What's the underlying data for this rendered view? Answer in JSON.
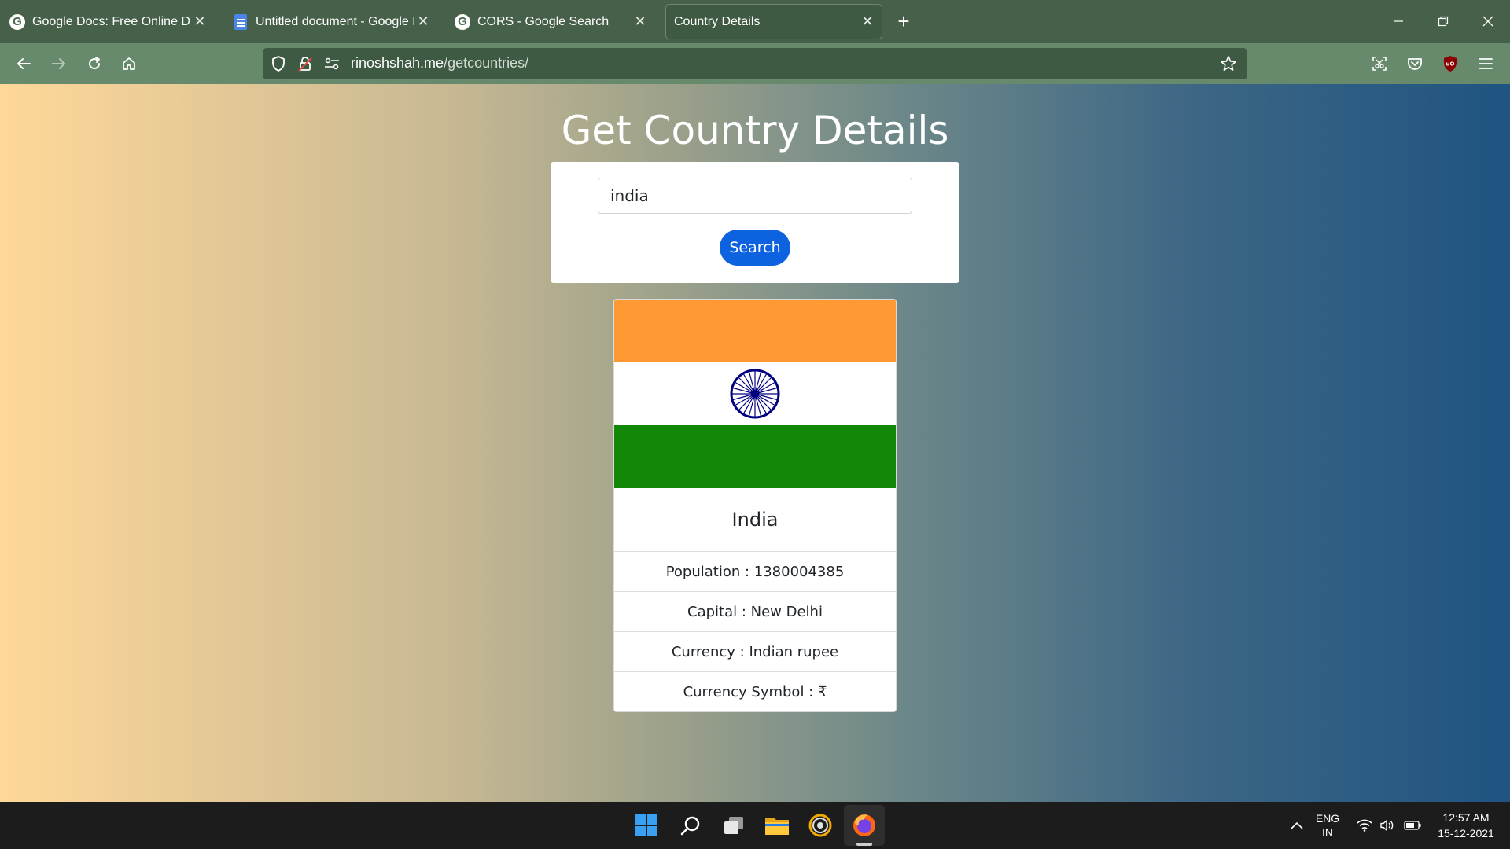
{
  "browser": {
    "tabs": [
      {
        "title": "Google Docs: Free Online Document Editor",
        "active": false,
        "icon": "google-g-icon"
      },
      {
        "title": "Untitled document - Google Docs",
        "active": false,
        "icon": "google-docs-icon"
      },
      {
        "title": "CORS - Google Search",
        "active": false,
        "icon": "google-g-icon"
      },
      {
        "title": "Country Details",
        "active": true,
        "icon": "none"
      }
    ],
    "new_tab_label": "+",
    "url_domain": "rinoshshah.me",
    "url_path": "/getcountries/"
  },
  "page": {
    "title": "Get Country Details",
    "search_value": "india",
    "search_button": "Search",
    "country": {
      "name": "India",
      "flag_colors": [
        "#ff9933",
        "#ffffff",
        "#138808"
      ],
      "chakra_color": "#000080",
      "details": [
        "Population : 1380004385",
        "Capital : New Delhi",
        "Currency : Indian rupee",
        "Currency Symbol : ₹"
      ]
    }
  },
  "taskbar": {
    "language_top": "ENG",
    "language_bottom": "IN",
    "time": "12:57 AM",
    "date": "15-12-2021"
  }
}
